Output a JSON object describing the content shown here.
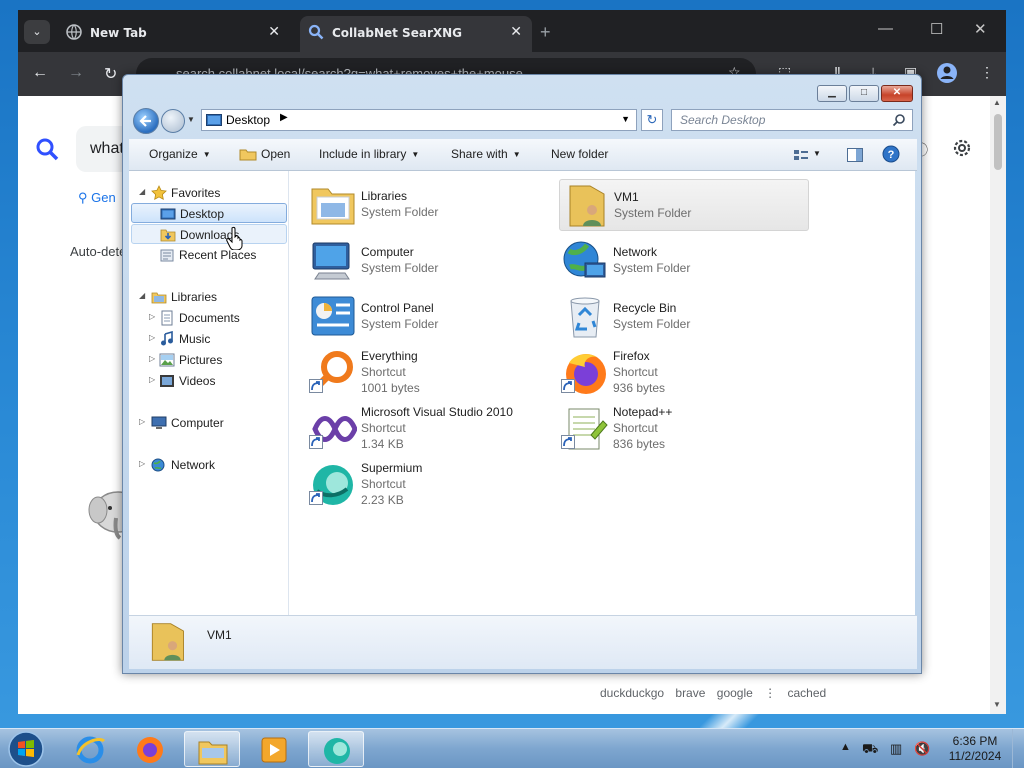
{
  "browser": {
    "tabs": [
      {
        "label": "New Tab",
        "close": "✕"
      },
      {
        "label": "CollabNet SearXNG",
        "close": "✕"
      }
    ],
    "new_tab": "+",
    "window_controls": {
      "minimize": "—",
      "maximize": "☐",
      "close": "✕"
    },
    "url": "search.collabnet.local/search?q=what+removes+the+mouse...",
    "page": {
      "search_query": "what",
      "general_tab": "Gen",
      "auto_detect": "Auto-dete",
      "engines": [
        "duckduckgo",
        "brave",
        "google",
        "⋮",
        "cached"
      ]
    }
  },
  "explorer": {
    "caption": {
      "minimize": "▁",
      "maximize": "□",
      "close": "✕"
    },
    "address": {
      "location": "Desktop",
      "separator": "▶",
      "dropdown": "▼"
    },
    "refresh": "↻",
    "search_placeholder": "Search Desktop",
    "commands": {
      "organize": "Organize",
      "open": "Open",
      "include_in_library": "Include in library",
      "share_with": "Share with",
      "new_folder": "New folder"
    },
    "nav": {
      "favorites": "Favorites",
      "desktop": "Desktop",
      "downloads": "Downloads",
      "recent_places": "Recent Places",
      "libraries": "Libraries",
      "documents": "Documents",
      "music": "Music",
      "pictures": "Pictures",
      "videos": "Videos",
      "computer": "Computer",
      "network": "Network"
    },
    "items": [
      {
        "name": "Libraries",
        "type": "System Folder",
        "size": ""
      },
      {
        "name": "VM1",
        "type": "System Folder",
        "size": ""
      },
      {
        "name": "Computer",
        "type": "System Folder",
        "size": ""
      },
      {
        "name": "Network",
        "type": "System Folder",
        "size": ""
      },
      {
        "name": "Control Panel",
        "type": "System Folder",
        "size": ""
      },
      {
        "name": "Recycle Bin",
        "type": "System Folder",
        "size": ""
      },
      {
        "name": "Everything",
        "type": "Shortcut",
        "size": "1001 bytes"
      },
      {
        "name": "Firefox",
        "type": "Shortcut",
        "size": "936 bytes"
      },
      {
        "name": "Microsoft Visual Studio 2010",
        "type": "Shortcut",
        "size": "1.34 KB"
      },
      {
        "name": "Notepad++",
        "type": "Shortcut",
        "size": "836 bytes"
      },
      {
        "name": "Supermium",
        "type": "Shortcut",
        "size": "2.23 KB"
      }
    ],
    "details": {
      "name": "VM1"
    }
  },
  "taskbar": {
    "clock_time": "6:36 PM",
    "clock_date": "11/2/2024",
    "tray_chevron": "▲"
  },
  "colors": {
    "desktop": "#1a74c4",
    "browser_chrome": "#202124",
    "explorer_frame": "#cfe0f1",
    "selection": "#cde3fb"
  }
}
